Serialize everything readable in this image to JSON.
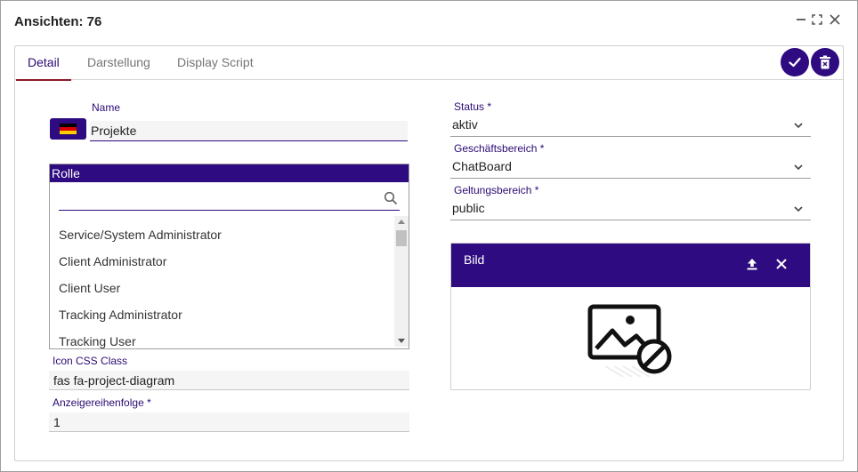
{
  "window": {
    "title": "Ansichten: 76",
    "controls": [
      "minimize-icon",
      "maximize-icon",
      "close-icon"
    ]
  },
  "tabs": [
    {
      "label": "Detail",
      "active": true
    },
    {
      "label": "Darstellung",
      "active": false
    },
    {
      "label": "Display Script",
      "active": false
    }
  ],
  "actions": {
    "save_icon": "check-icon",
    "delete_icon": "trash-icon"
  },
  "form": {
    "name": {
      "label": "Name",
      "value": "Projekte",
      "language_flag": "de-flag-icon"
    },
    "rolle": {
      "title": "Rolle",
      "search_placeholder": "",
      "items": [
        "Service/System Administrator",
        "Client Administrator",
        "Client User",
        "Tracking Administrator",
        "Tracking User"
      ]
    },
    "icon_css": {
      "label": "Icon CSS Class",
      "value": "fas fa-project-diagram"
    },
    "order": {
      "label": "Anzeigereihenfolge *",
      "value": "1"
    },
    "status": {
      "label": "Status *",
      "value": "aktiv"
    },
    "business": {
      "label": "Geschäftsbereich *",
      "value": "ChatBoard"
    },
    "scope": {
      "label": "Geltungsbereich *",
      "value": "public"
    },
    "bild": {
      "title": "Bild",
      "upload_icon": "upload-icon",
      "clear_icon": "close-icon",
      "placeholder_icon": "image-off-icon"
    }
  },
  "colors": {
    "primary": "#2e0b80",
    "tab_underline": "#8b1a2b",
    "label": "#2b0a73"
  }
}
